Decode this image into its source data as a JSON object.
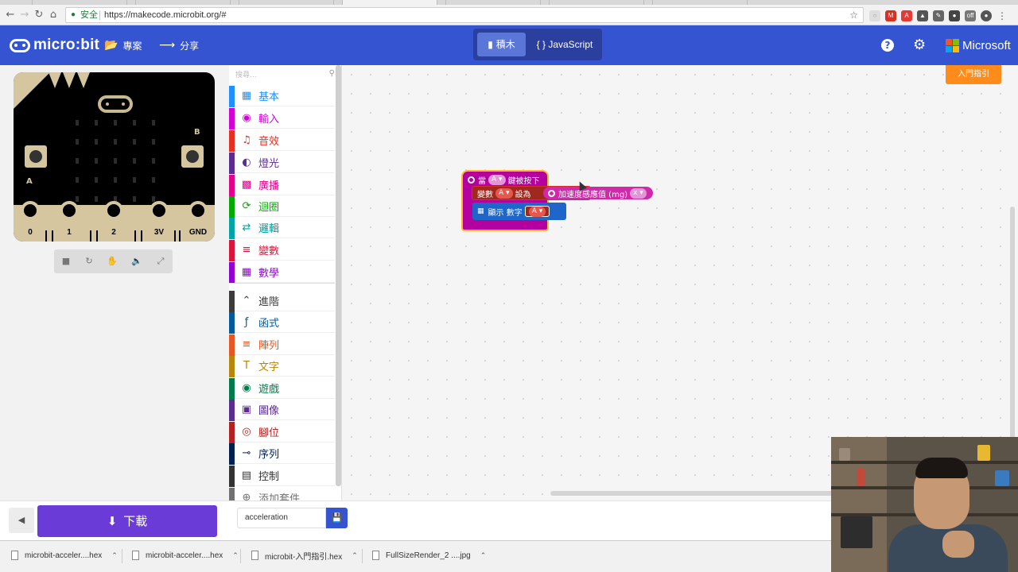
{
  "browser": {
    "secure_label": "安全",
    "url": "https://makecode.microbit.org/#"
  },
  "header": {
    "logo_text": "micro:bit",
    "projects_label": "專案",
    "share_label": "分享",
    "blocks_label": "積木",
    "javascript_label": "JavaScript",
    "microsoft_label": "Microsoft",
    "brand_color": "#3454d1"
  },
  "simulator": {
    "pin_labels": [
      "0",
      "1",
      "2",
      "3V",
      "GND"
    ],
    "button_a": "A",
    "button_b": "B"
  },
  "toolbox": {
    "search_placeholder": "搜尋...",
    "categories": [
      {
        "label": "基本",
        "color": "#1e90ff",
        "icon": "grid-icon"
      },
      {
        "label": "輸入",
        "color": "#d400d4",
        "icon": "target-icon"
      },
      {
        "label": "音效",
        "color": "#e63022",
        "icon": "headphones-icon"
      },
      {
        "label": "燈光",
        "color": "#5c2d91",
        "icon": "toggle-icon"
      },
      {
        "label": "廣播",
        "color": "#e3008c",
        "icon": "signal-icon"
      },
      {
        "label": "迴圈",
        "color": "#00aa00",
        "icon": "loop-icon"
      },
      {
        "label": "邏輯",
        "color": "#00a4a6",
        "icon": "shuffle-icon"
      },
      {
        "label": "變數",
        "color": "#dc143c",
        "icon": "list-icon"
      },
      {
        "label": "數學",
        "color": "#9400d3",
        "icon": "calculator-icon"
      }
    ],
    "advanced": [
      {
        "label": "進階",
        "color": "#3c3c3c",
        "icon": "chevron-up-icon"
      },
      {
        "label": "函式",
        "color": "#005a9e",
        "icon": "function-icon"
      },
      {
        "label": "陣列",
        "color": "#e65722",
        "icon": "array-icon"
      },
      {
        "label": "文字",
        "color": "#b8860b",
        "icon": "text-icon"
      },
      {
        "label": "遊戲",
        "color": "#007a4b",
        "icon": "gamepad-icon"
      },
      {
        "label": "圖像",
        "color": "#5c2d91",
        "icon": "image-icon"
      },
      {
        "label": "腳位",
        "color": "#b22222",
        "icon": "pin-icon"
      },
      {
        "label": "序列",
        "color": "#002050",
        "icon": "usb-icon"
      },
      {
        "label": "控制",
        "color": "#333333",
        "icon": "control-icon"
      },
      {
        "label": "添加套件",
        "color": "#717171",
        "icon": "plus-icon"
      }
    ]
  },
  "workspace": {
    "guide_button": "入門指引",
    "hat_label": "當",
    "hat_key": "A",
    "hat_suffix": "鍵被按下",
    "set_label": "變數",
    "set_var": "A",
    "set_to": "設為",
    "acc_label": "加速度感應值 (mg)",
    "acc_axis": "x",
    "show_label": "顯示 數字",
    "show_var": "A"
  },
  "bottom": {
    "download_label": "下載",
    "project_name": "acceleration"
  },
  "downloads": [
    "microbit-acceler....hex",
    "microbit-acceler....hex",
    "microbit-入門指引.hex",
    "FullSizeRender_2 ....jpg"
  ]
}
